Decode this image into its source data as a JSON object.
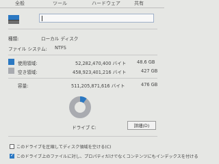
{
  "tabs": [
    "全般",
    "ツール",
    "ハードウェア",
    "共有"
  ],
  "drive_name": "",
  "type": {
    "label": "種類:",
    "value": "ローカル ディスク"
  },
  "filesystem": {
    "label": "ファイル システム:",
    "value": "NTFS"
  },
  "used": {
    "label": "使用領域:",
    "bytes": "52,282,470,400 バイト",
    "size": "48.6 GB",
    "color": "#2b78c2"
  },
  "free": {
    "label": "空き領域:",
    "bytes": "458,923,401,216 バイト",
    "size": "427 GB",
    "color": "#a9abb0"
  },
  "capacity": {
    "label": "容量:",
    "bytes": "511,205,871,616 バイト",
    "size": "476 GB"
  },
  "drive_label": "ドライブ C:",
  "cleanup_button": "詳細(D)",
  "checkboxes": [
    {
      "label": "このドライブを圧縮してディスク領域を空ける(C)",
      "checked": false
    },
    {
      "label": "このドライブ上のファイルに対し、プロパティだけでなくコンテンツにもインデックスを付ける",
      "checked": true
    }
  ]
}
